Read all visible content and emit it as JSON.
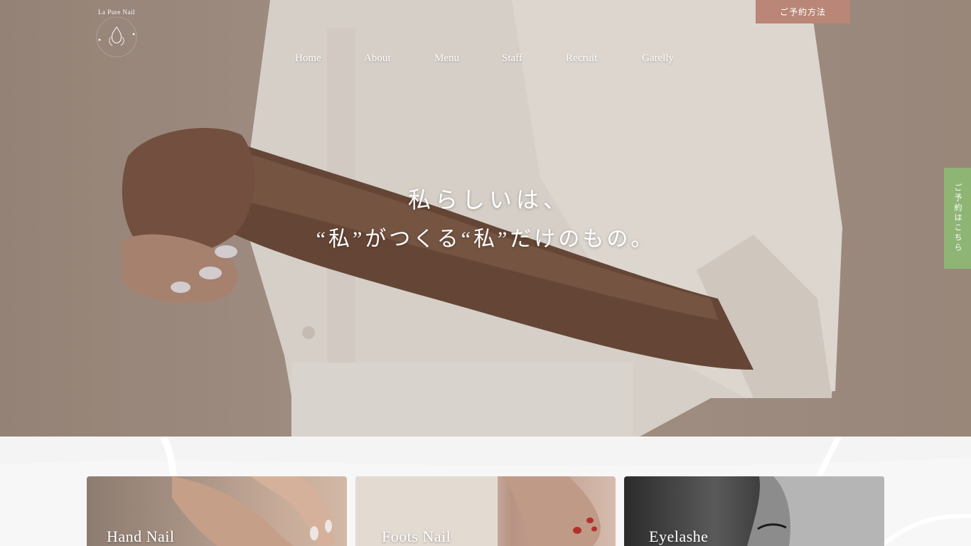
{
  "brand": {
    "logo_text": "La Pure Nail"
  },
  "nav": {
    "items": [
      "Home",
      "About",
      "Menu",
      "Staff",
      "Recruit",
      "Garelly"
    ]
  },
  "header": {
    "reserve_label": "ご予約方法"
  },
  "side_tab": {
    "label": "ご予約はこちら"
  },
  "hero": {
    "line1": "私らしいは、",
    "line2": "“私”がつくる“私”だけのもの。"
  },
  "cards": [
    {
      "title": "Hand Nail"
    },
    {
      "title": "Foots Nail"
    },
    {
      "title": "Eyelashe"
    }
  ],
  "colors": {
    "reserve_button": "#b98677",
    "side_tab": "#8fb575",
    "page_background": "#f4f4f4"
  }
}
